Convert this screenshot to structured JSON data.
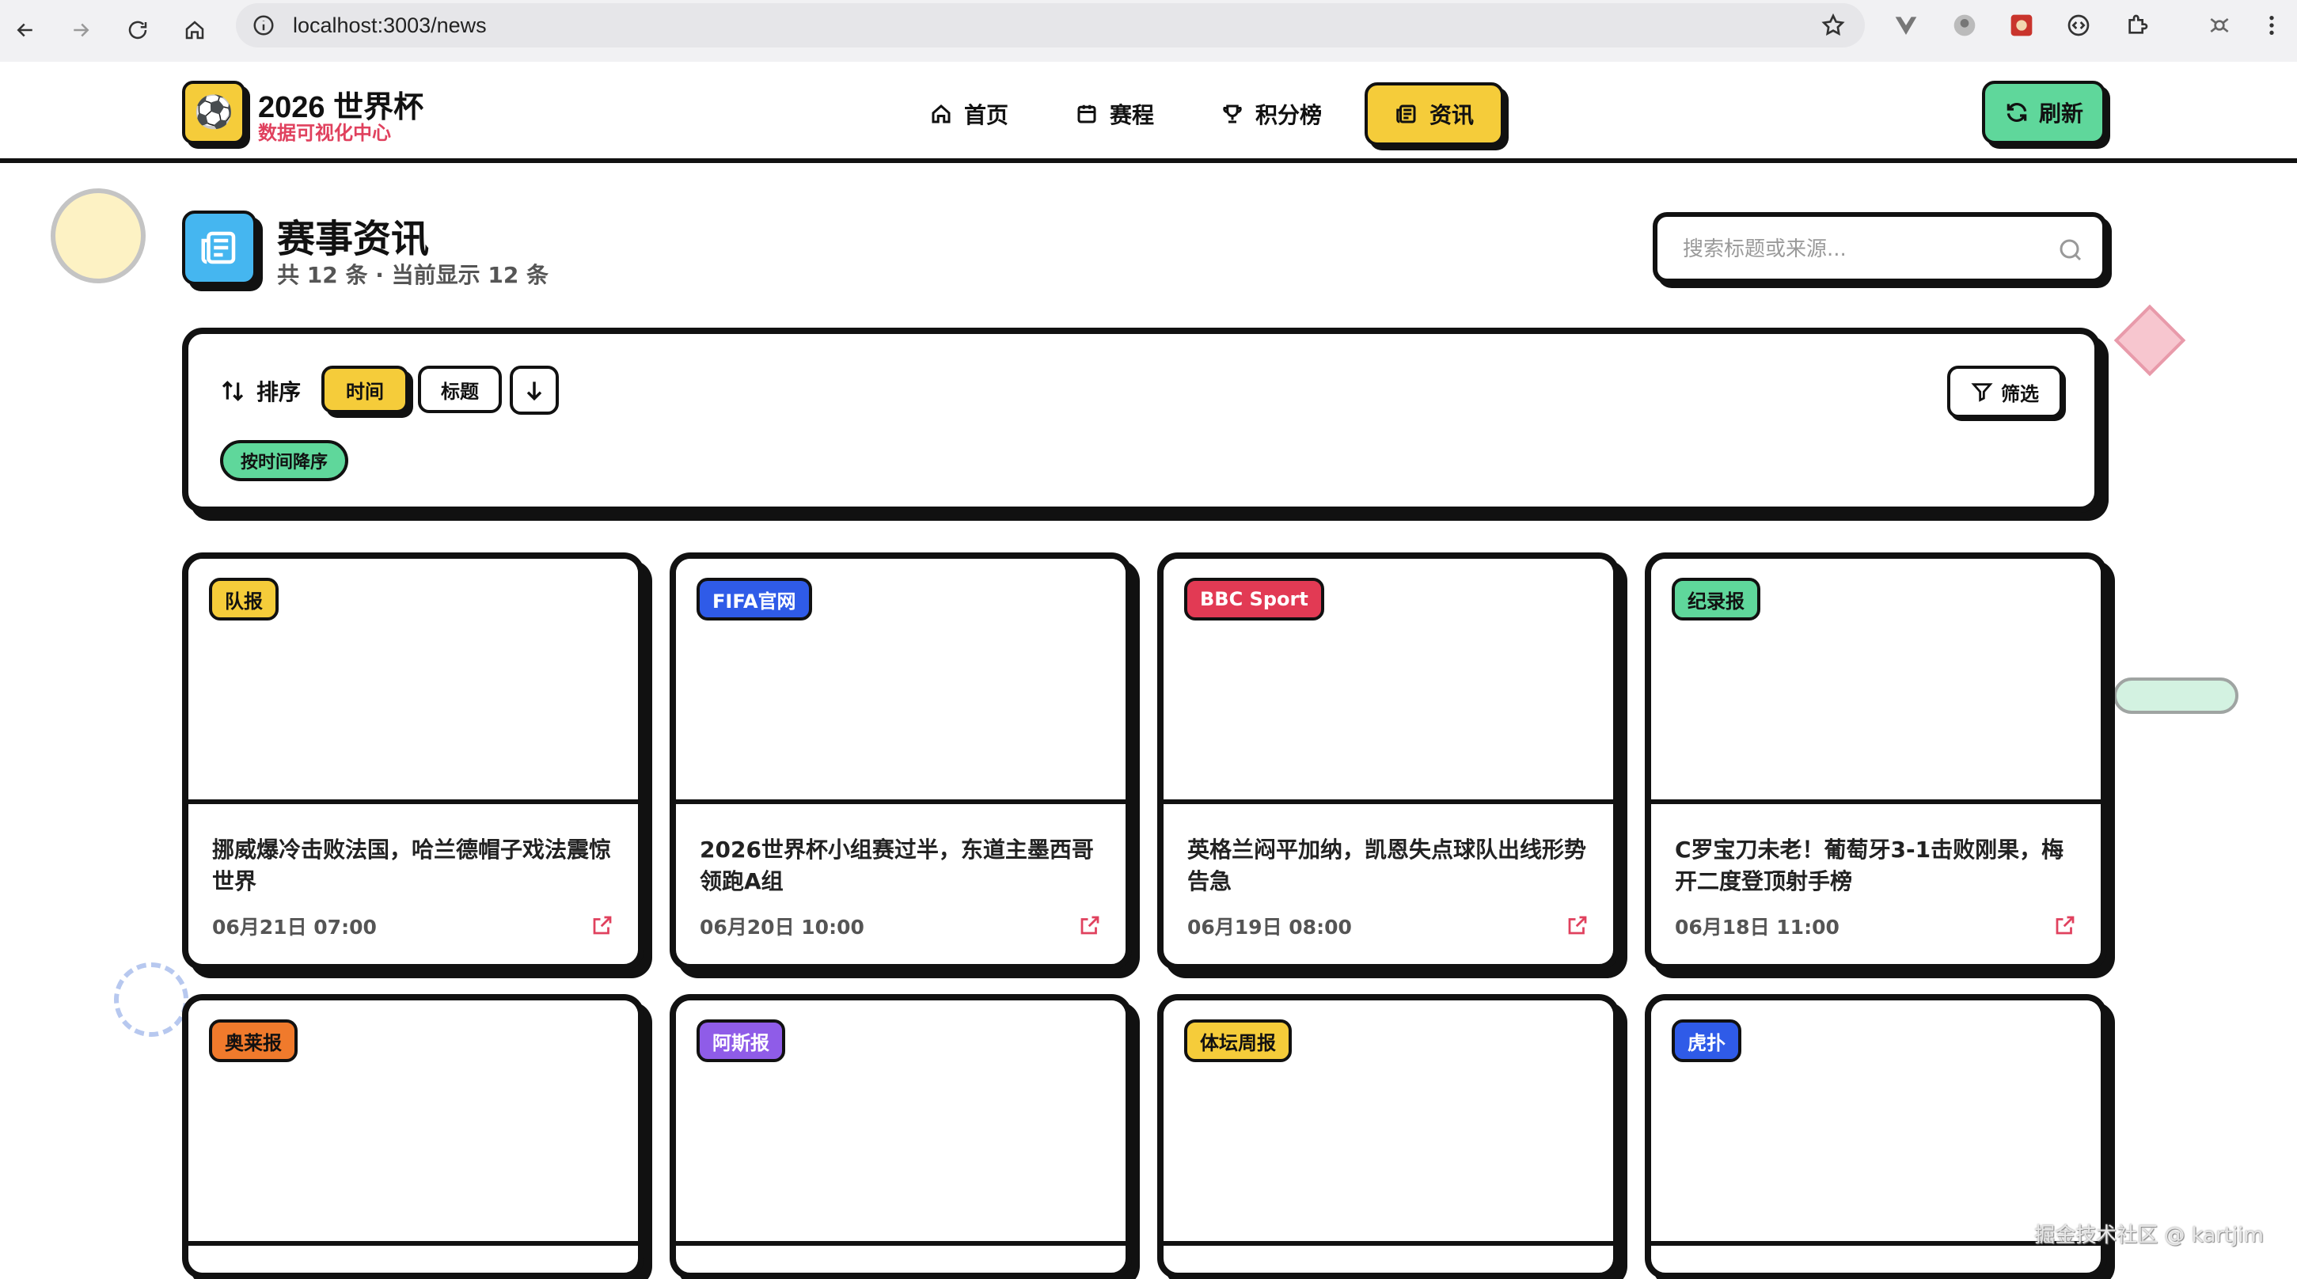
{
  "browser": {
    "url": "localhost:3003/news"
  },
  "header": {
    "logo_emoji": "⚽",
    "logo_title": "2026 世界杯",
    "logo_subtitle": "数据可视化中心",
    "nav": [
      {
        "label": "首页",
        "icon": "home-icon"
      },
      {
        "label": "赛程",
        "icon": "calendar-icon"
      },
      {
        "label": "积分榜",
        "icon": "trophy-icon"
      },
      {
        "label": "资讯",
        "icon": "newspaper-icon",
        "active": true
      }
    ],
    "refresh_label": "刷新"
  },
  "page": {
    "title": "赛事资讯",
    "subtitle": "共 12 条 · 当前显示 12 条",
    "search_placeholder": "搜索标题或来源..."
  },
  "filter": {
    "sort_label": "排序",
    "sort_options": [
      "时间",
      "标题"
    ],
    "active_sort": "时间",
    "filter_label": "筛选",
    "status_tag": "按时间降序"
  },
  "colors": {
    "accent_yellow": "#f5cc3a",
    "accent_green": "#5fd79b",
    "accent_blue": "#45b6f0",
    "accent_pink": "#e0415e"
  },
  "news": [
    {
      "source": "队报",
      "source_color": "#f5cc3a",
      "title": "挪威爆冷击败法国，哈兰德帽子戏法震惊世界",
      "date": "06月21日 07:00"
    },
    {
      "source": "FIFA官网",
      "source_color": "#2f5be8",
      "title": "2026世界杯小组赛过半，东道主墨西哥领跑A组",
      "date": "06月20日 10:00"
    },
    {
      "source": "BBC Sport",
      "source_color": "#e23a54",
      "title": "英格兰闷平加纳，凯恩失点球队出线形势告急",
      "date": "06月19日 08:00"
    },
    {
      "source": "纪录报",
      "source_color": "#5fd79b",
      "title": "C罗宝刀未老！葡萄牙3-1击败刚果，梅开二度登顶射手榜",
      "date": "06月18日 11:00"
    },
    {
      "source": "奥莱报",
      "source_color": "#f07a2c",
      "title": "",
      "date": ""
    },
    {
      "source": "阿斯报",
      "source_color": "#8f5ce8",
      "title": "",
      "date": ""
    },
    {
      "source": "体坛周报",
      "source_color": "#f5cc3a",
      "title": "",
      "date": ""
    },
    {
      "source": "虎扑",
      "source_color": "#2f5be8",
      "title": "",
      "date": ""
    }
  ],
  "watermark": "掘金技术社区 @ kartjim"
}
